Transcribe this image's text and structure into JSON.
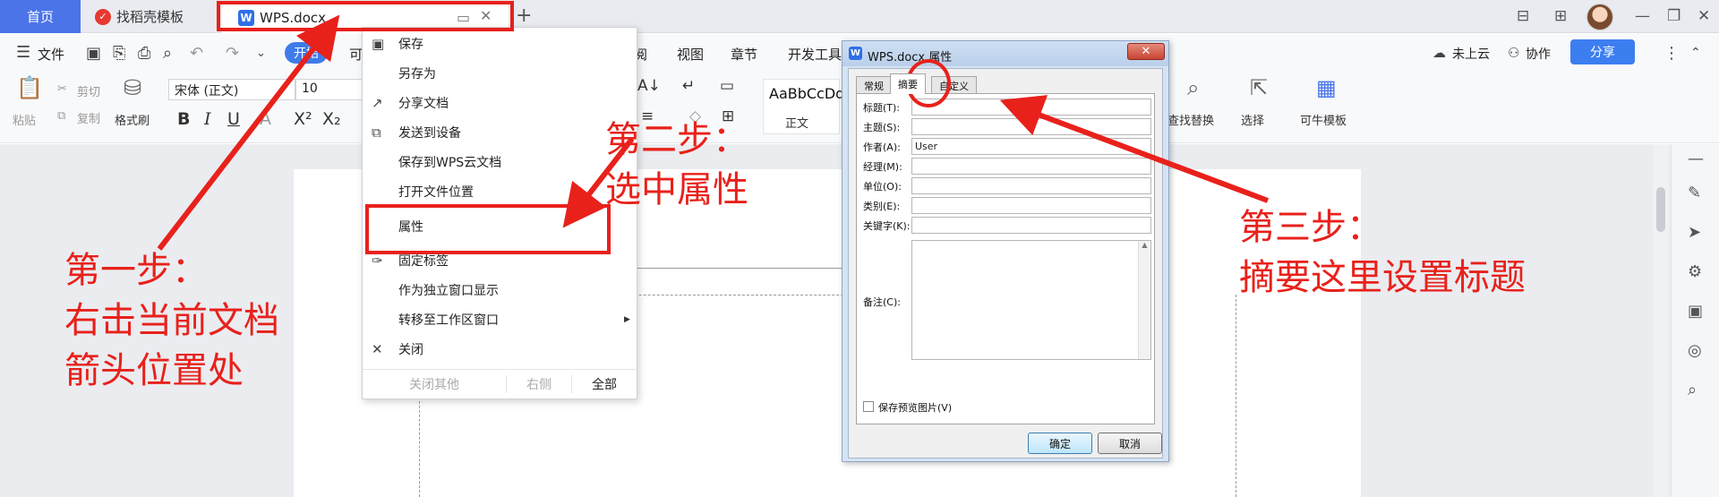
{
  "tabs": {
    "home": "首页",
    "template": "找稻壳模板",
    "doc": "WPS.docx"
  },
  "menu": {
    "file": "文件",
    "kaishi": "开始",
    "insert_partial": "可",
    "review_partial": "阅",
    "view": "视图",
    "chapter": "章节",
    "devtools": "开发工具",
    "cloud": "未上云",
    "collab": "协作",
    "share": "分享"
  },
  "ribbon": {
    "paste": "粘贴",
    "cut": "剪切",
    "copy": "复制",
    "format_painter": "格式刷",
    "font_name": "宋体 (正文)",
    "font_size": "10",
    "style_sample": "AaBbCcDd",
    "style_name": "正文",
    "find_replace": "查找替换",
    "select": "选择",
    "template": "可牛模板"
  },
  "context_menu": {
    "items": [
      {
        "icon": "save-icon",
        "label": "保存"
      },
      {
        "icon": "",
        "label": "另存为"
      },
      {
        "icon": "share-icon",
        "label": "分享文档"
      },
      {
        "icon": "device-icon",
        "label": "发送到设备"
      },
      {
        "icon": "",
        "label": "保存到WPS云文档"
      },
      {
        "icon": "",
        "label": "打开文件位置"
      },
      {
        "icon": "",
        "label": "属性"
      },
      {
        "icon": "pin-icon",
        "label": "固定标签"
      },
      {
        "icon": "",
        "label": "作为独立窗口显示"
      },
      {
        "icon": "",
        "label": "转移至工作区窗口"
      },
      {
        "icon": "close-icon",
        "label": "关闭"
      }
    ],
    "bottom": {
      "close_others": "关闭其他",
      "right": "右侧",
      "all": "全部"
    }
  },
  "dialog": {
    "title": "WPS.docx 属性",
    "tabs": [
      "常规",
      "摘要",
      "自定义"
    ],
    "fields": [
      {
        "label": "标题(T):",
        "value": ""
      },
      {
        "label": "主题(S):",
        "value": ""
      },
      {
        "label": "作者(A):",
        "value": "User"
      },
      {
        "label": "经理(M):",
        "value": ""
      },
      {
        "label": "单位(O):",
        "value": ""
      },
      {
        "label": "类别(E):",
        "value": ""
      },
      {
        "label": "关键字(K):",
        "value": ""
      }
    ],
    "notes_label": "备注(C):",
    "save_preview": "保存预览图片(V)",
    "ok": "确定",
    "cancel": "取消"
  },
  "annotations": {
    "step1": [
      "第一步：",
      "右击当前文档",
      "箭头位置处"
    ],
    "step2": [
      "第二步：",
      "选中属性"
    ],
    "step3": [
      "第三步：",
      "摘要这里设置标题"
    ]
  },
  "colors": {
    "accent": "#4a74e8",
    "annotation_red": "#e8211b"
  }
}
